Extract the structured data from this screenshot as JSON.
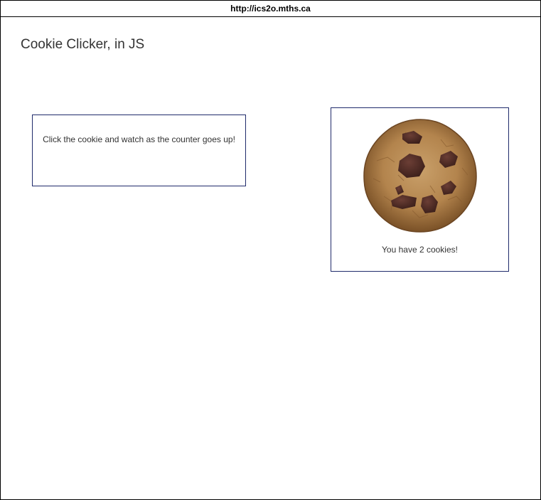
{
  "browser": {
    "url": "http://ics2o.mths.ca"
  },
  "page": {
    "title": "Cookie Clicker, in JS"
  },
  "info_card": {
    "text": "Click the cookie and watch as the counter goes up!"
  },
  "cookie_card": {
    "cookie_icon": "cookie-icon",
    "counter_text": "You have 2 cookies!"
  },
  "colors": {
    "card_border": "#1f2a6b",
    "text": "#333333",
    "cookie_dough": "#b88a50",
    "chocolate_chip": "#4a2a24"
  }
}
